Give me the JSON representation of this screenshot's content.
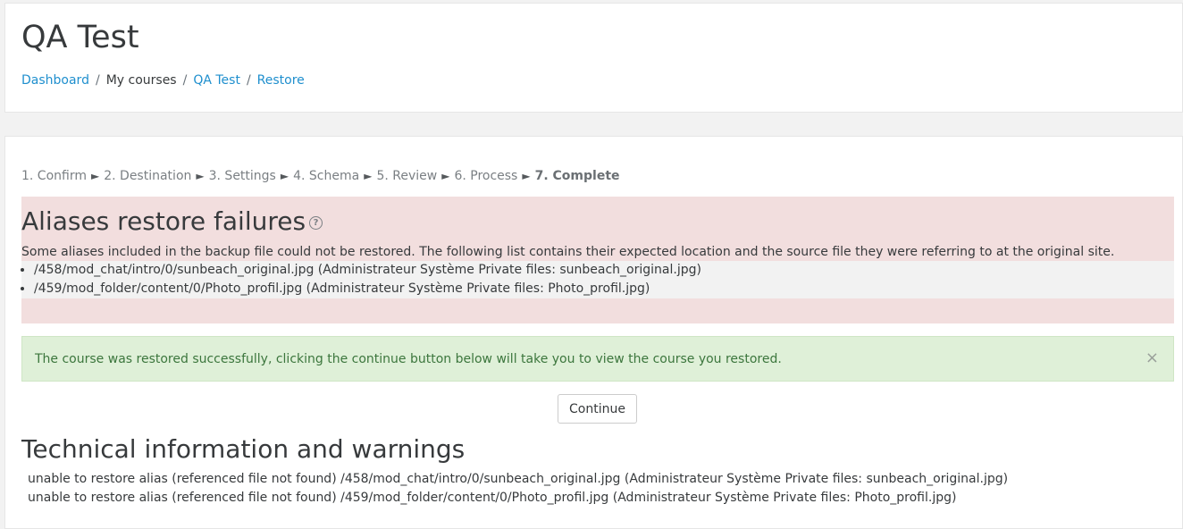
{
  "header": {
    "title": "QA Test",
    "breadcrumb": {
      "dashboard": "Dashboard",
      "my_courses": "My courses",
      "course": "QA Test",
      "restore": "Restore",
      "separator": "/"
    }
  },
  "steps": {
    "items": [
      "1. Confirm",
      "2. Destination",
      "3. Settings",
      "4. Schema",
      "5. Review",
      "6. Process",
      "7. Complete"
    ],
    "arrow": "►"
  },
  "failures": {
    "heading": "Aliases restore failures",
    "help_icon": "question-circle-icon",
    "description": "Some aliases included in the backup file could not be restored. The following list contains their expected location and the source file they were referring to at the original site.",
    "items": [
      "/458/mod_chat/intro/0/sunbeach_original.jpg (Administrateur Système Private files: sunbeach_original.jpg)",
      "/459/mod_folder/content/0/Photo_profil.jpg (Administrateur Système Private files: Photo_profil.jpg)"
    ]
  },
  "success": {
    "message": "The course was restored successfully, clicking the continue button below will take you to view the course you restored.",
    "close_label": "×"
  },
  "continue_label": "Continue",
  "tech": {
    "heading": "Technical information and warnings",
    "lines": [
      "unable to restore alias (referenced file not found) /458/mod_chat/intro/0/sunbeach_original.jpg (Administrateur Système Private files: sunbeach_original.jpg)",
      "unable to restore alias (referenced file not found) /459/mod_folder/content/0/Photo_profil.jpg (Administrateur Système Private files: Photo_profil.jpg)"
    ]
  },
  "colors": {
    "link": "#1f8fce",
    "danger_bg": "#f2dede",
    "success_bg": "#dff0d8",
    "success_text": "#3c763d"
  }
}
